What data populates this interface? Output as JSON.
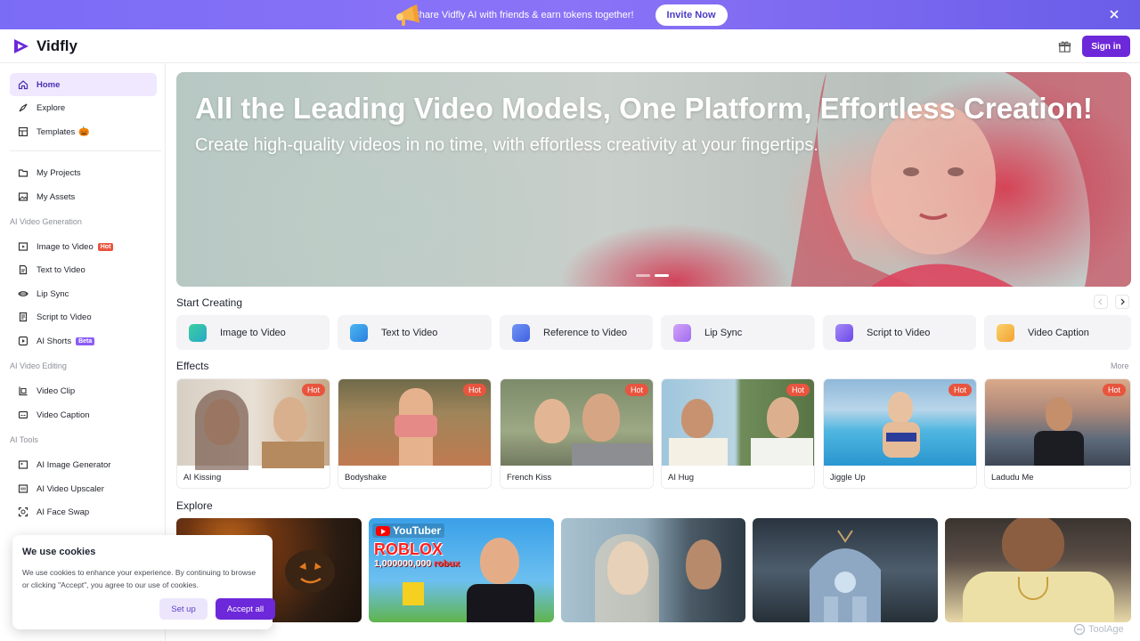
{
  "promo": {
    "text": "Share Vidfly AI with friends & earn tokens together!",
    "button": "Invite Now"
  },
  "header": {
    "brand": "Vidfly",
    "signin": "Sign in"
  },
  "sidebar": {
    "top_items": [
      {
        "label": "Home",
        "icon": "home-icon",
        "active": true
      },
      {
        "label": "Explore",
        "icon": "compass-icon"
      },
      {
        "label": "Templates",
        "icon": "template-icon",
        "emoji": "🎃"
      }
    ],
    "personal_items": [
      {
        "label": "My Projects",
        "icon": "folder-icon"
      },
      {
        "label": "My Assets",
        "icon": "image-icon"
      }
    ],
    "sections": [
      {
        "title": "AI Video Generation",
        "items": [
          {
            "label": "Image to Video",
            "badge": "Hot"
          },
          {
            "label": "Text to Video"
          },
          {
            "label": "Lip Sync"
          },
          {
            "label": "Script to Video"
          },
          {
            "label": "AI Shorts",
            "badge": "Beta"
          }
        ]
      },
      {
        "title": "AI Video Editing",
        "items": [
          {
            "label": "Video Clip"
          },
          {
            "label": "Video Caption"
          }
        ]
      },
      {
        "title": "AI Tools",
        "items": [
          {
            "label": "AI Image Generator"
          },
          {
            "label": "AI Video Upscaler"
          },
          {
            "label": "AI Face Swap"
          }
        ]
      }
    ]
  },
  "hero": {
    "title": "All the Leading Video Models, One Platform, Effortless Creation!",
    "subtitle": "Create high-quality videos in no time, with effortless creativity at your fingertips."
  },
  "start_creating": {
    "title": "Start Creating",
    "cards": [
      {
        "label": "Image to Video",
        "color": "#34c38f"
      },
      {
        "label": "Text to Video",
        "color": "#3aa7e8"
      },
      {
        "label": "Reference to Video",
        "color": "#4f7cf0"
      },
      {
        "label": "Lip Sync",
        "color": "#b27cf2"
      },
      {
        "label": "Script to Video",
        "color": "#8a63f0"
      },
      {
        "label": "Video Caption",
        "color": "#f5b63a"
      }
    ]
  },
  "effects": {
    "title": "Effects",
    "more": "More",
    "hot_label": "Hot",
    "cards": [
      {
        "label": "AI Kissing"
      },
      {
        "label": "Bodyshake"
      },
      {
        "label": "French Kiss"
      },
      {
        "label": "AI Hug"
      },
      {
        "label": "Jiggle Up"
      },
      {
        "label": "Ladudu Me"
      }
    ]
  },
  "explore": {
    "title": "Explore",
    "youtube_card": {
      "logo": "YouTuber",
      "game": "ROBLOX",
      "amount": "1,000000,000",
      "currency": "robux"
    }
  },
  "cookie": {
    "title": "We use cookies",
    "body": "We use cookies to enhance your experience. By continuing to browse or clicking \"Accept\", you agree to our use of cookies.",
    "setup": "Set up",
    "accept": "Accept all"
  },
  "watermark": "ToolAge"
}
